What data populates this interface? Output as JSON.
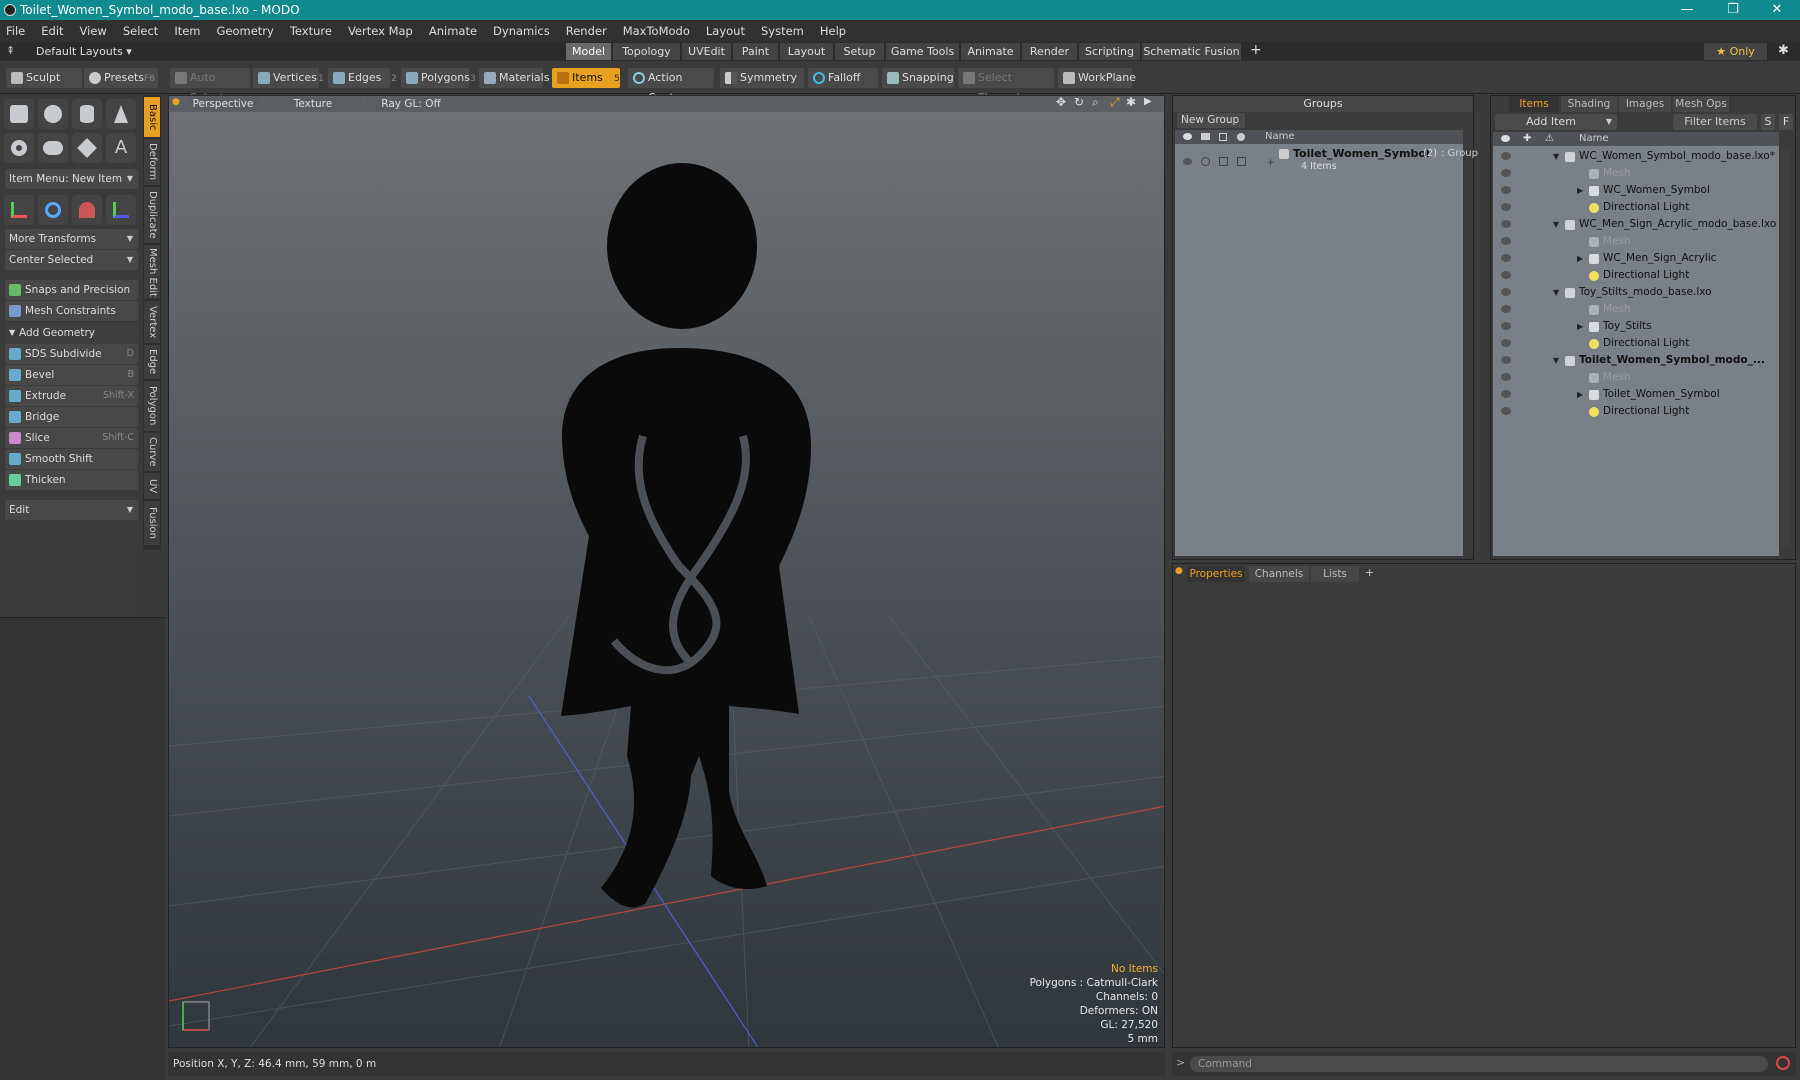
{
  "window": {
    "title": "Toilet_Women_Symbol_modo_base.lxo - MODO",
    "minimize": "—",
    "maximize": "❐",
    "close": "✕"
  },
  "menu": [
    "File",
    "Edit",
    "View",
    "Select",
    "Item",
    "Geometry",
    "Texture",
    "Vertex Map",
    "Animate",
    "Dynamics",
    "Render",
    "MaxToModo",
    "Layout",
    "System",
    "Help"
  ],
  "layout_row": {
    "default_layouts": "Default Layouts ▾",
    "tabs": [
      "Model",
      "Topology",
      "UVEdit",
      "Paint",
      "Layout",
      "Setup",
      "Game Tools",
      "Animate",
      "Render",
      "Scripting",
      "Schematic Fusion"
    ],
    "active_tab": "Model",
    "add": "+",
    "only": "★  Only",
    "gear": "✱"
  },
  "toolbar": {
    "sculpt": "Sculpt",
    "presets": "Presets",
    "presets_key": "F6",
    "auto_select": "Auto Select",
    "vertices": "Vertices",
    "vertices_key": "1",
    "edges": "Edges",
    "edges_key": "2",
    "polygons": "Polygons",
    "polygons_key": "3",
    "materials": "Materials",
    "items": "Items",
    "items_key": "5",
    "action_center": "Action Center",
    "symmetry": "Symmetry",
    "falloff": "Falloff",
    "snapping": "Snapping",
    "select_through": "Select Through",
    "workplane": "WorkPlane"
  },
  "left_panel": {
    "item_menu": "Item Menu: New Item",
    "more_transforms": "More Transforms",
    "center_selected": "Center Selected",
    "snaps": "Snaps and Precision",
    "mesh_constraints": "Mesh Constraints",
    "add_geometry": "Add Geometry",
    "tools": [
      {
        "label": "SDS Subdivide",
        "key": "D"
      },
      {
        "label": "Bevel",
        "key": "B"
      },
      {
        "label": "Extrude",
        "key": "Shift-X"
      },
      {
        "label": "Bridge",
        "key": ""
      },
      {
        "label": "Slice",
        "key": "Shift-C"
      },
      {
        "label": "Smooth Shift",
        "key": ""
      },
      {
        "label": "Thicken",
        "key": ""
      }
    ],
    "edit": "Edit",
    "vtabs": [
      "Basic",
      "Deform",
      "Duplicate",
      "Mesh Edit",
      "Vertex",
      "Edge",
      "Polygon",
      "Curve",
      "UV",
      "Fusion"
    ]
  },
  "viewport": {
    "view": "Perspective",
    "shading": "Texture",
    "raygl": "Ray GL: Off",
    "info": {
      "no_items": "No Items",
      "polygons": "Polygons : Catmull-Clark",
      "channels": "Channels: 0",
      "deformers": "Deformers: ON",
      "gl": "GL: 27,520",
      "scale": "5 mm"
    },
    "status": "Position X, Y, Z:  46.4 mm, 59 mm, 0 m"
  },
  "groups": {
    "title": "Groups",
    "new_group": "New Group",
    "name_col": "Name",
    "group_name": "Toilet_Women_Symbol",
    "group_count": "(2)",
    "group_type": ": Group",
    "group_items": "4 Items"
  },
  "items_panel": {
    "tabs": [
      "Items",
      "Shading",
      "Images",
      "Mesh Ops"
    ],
    "add_item": "Add Item",
    "filter": "Filter Items",
    "btn_s": "S",
    "btn_f": "F",
    "name_col": "Name",
    "rows": [
      {
        "label": "WC_Women_Symbol_modo_base.lxo*",
        "level": 0,
        "type": "scene",
        "bold": false,
        "dim": false
      },
      {
        "label": "Mesh",
        "level": 1,
        "type": "mesh",
        "bold": false,
        "dim": true
      },
      {
        "label": "WC_Women_Symbol",
        "level": 1,
        "type": "group",
        "bold": false,
        "dim": false
      },
      {
        "label": "Directional Light",
        "level": 1,
        "type": "light",
        "bold": false,
        "dim": false
      },
      {
        "label": "WC_Men_Sign_Acrylic_modo_base.lxo",
        "level": 0,
        "type": "scene",
        "bold": false,
        "dim": false
      },
      {
        "label": "Mesh",
        "level": 1,
        "type": "mesh",
        "bold": false,
        "dim": true
      },
      {
        "label": "WC_Men_Sign_Acrylic",
        "level": 1,
        "type": "group",
        "bold": false,
        "dim": false
      },
      {
        "label": "Directional Light",
        "level": 1,
        "type": "light",
        "bold": false,
        "dim": false
      },
      {
        "label": "Toy_Stilts_modo_base.lxo",
        "level": 0,
        "type": "scene",
        "bold": false,
        "dim": false
      },
      {
        "label": "Mesh",
        "level": 1,
        "type": "mesh",
        "bold": false,
        "dim": true
      },
      {
        "label": "Toy_Stilts",
        "level": 1,
        "type": "group",
        "bold": false,
        "dim": false
      },
      {
        "label": "Directional Light",
        "level": 1,
        "type": "light",
        "bold": false,
        "dim": false
      },
      {
        "label": "Toilet_Women_Symbol_modo_...",
        "level": 0,
        "type": "scene",
        "bold": true,
        "dim": false
      },
      {
        "label": "Mesh",
        "level": 1,
        "type": "mesh",
        "bold": false,
        "dim": true
      },
      {
        "label": "Toilet_Women_Symbol",
        "level": 1,
        "type": "group",
        "bold": false,
        "dim": false
      },
      {
        "label": "Directional Light",
        "level": 1,
        "type": "light",
        "bold": false,
        "dim": false
      }
    ]
  },
  "properties": {
    "tabs": [
      "Properties",
      "Channels",
      "Lists"
    ],
    "add": "+"
  },
  "command": {
    "placeholder": "Command",
    "prompt": ">"
  },
  "colors": {
    "accent": "#e8a020",
    "titlebar": "#0f8a8e",
    "list_bg": "#7a8087"
  }
}
